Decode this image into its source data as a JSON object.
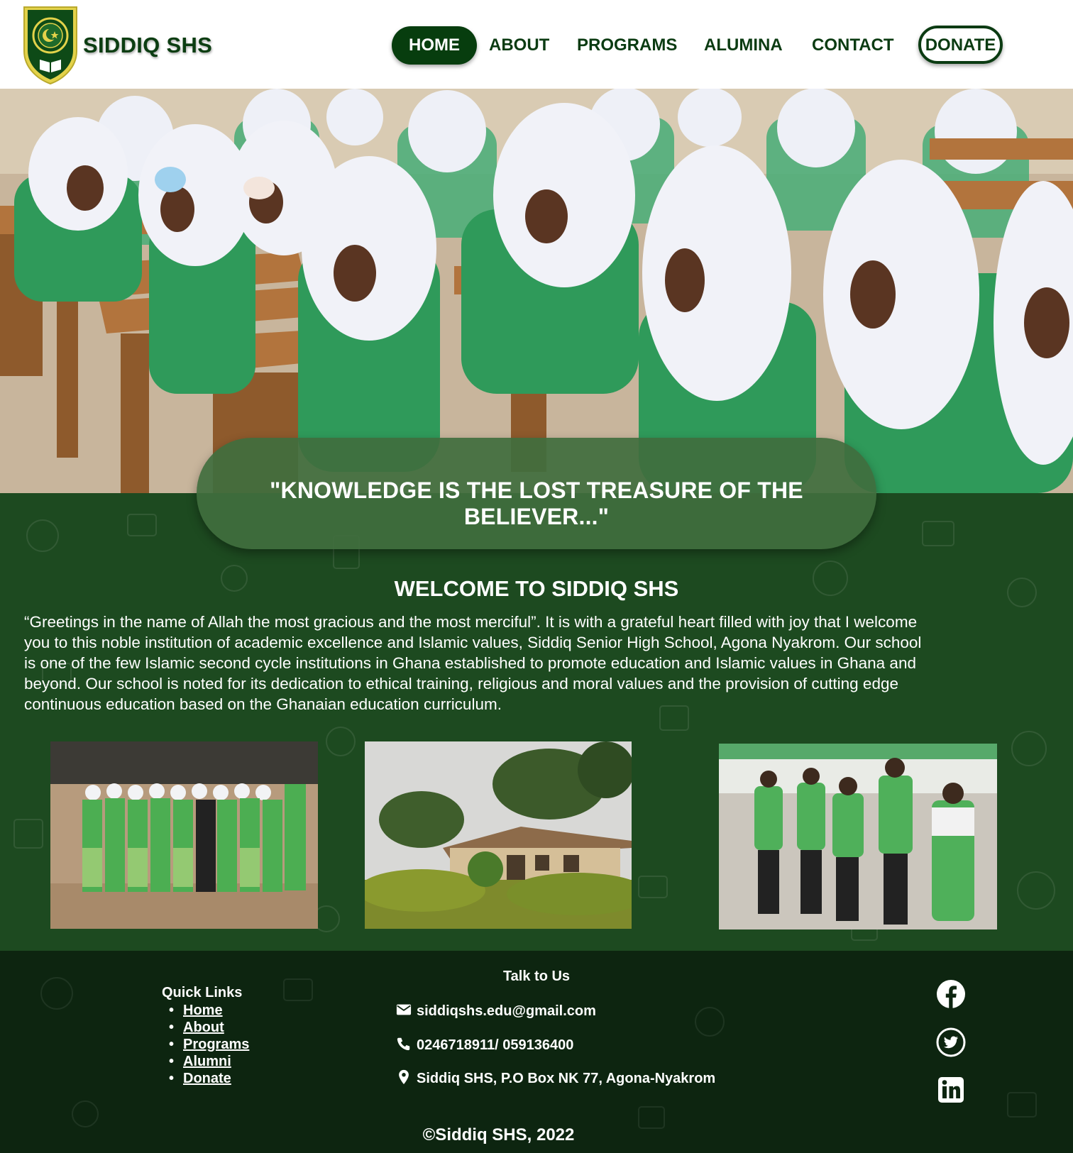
{
  "header": {
    "brand": "SIDDIQ SHS",
    "nav": {
      "home": "HOME",
      "about": "ABOUT",
      "programs": "PROGRAMS",
      "alumina": "ALUMINA",
      "contact": "CONTACT",
      "donate": "DONATE"
    }
  },
  "hero": {
    "quote": "\"KNOWLEDGE IS THE LOST TREASURE OF THE BELIEVER...\""
  },
  "welcome": {
    "title": "WELCOME TO SIDDIQ SHS",
    "body": "“Greetings in the name of Allah the most gracious and the most merciful”. It is with a grateful heart filled with joy that I welcome\n you to this noble institution of academic excellence and Islamic values, Siddiq Senior High School, Agona Nyakrom. Our school\nis one of the few Islamic second cycle institutions in Ghana established to promote education and Islamic values in Ghana and\nbeyond. Our school is noted for its dedication to ethical training, religious and moral values and the provision of cutting edge\n continuous education based on the Ghanaian education curriculum."
  },
  "footer": {
    "quick_links_title": "Quick Links",
    "quick_links": [
      "Home",
      "About",
      "Programs",
      "Alumni",
      "Donate"
    ],
    "talk_title": "Talk to Us",
    "email": "siddiqshs.edu@gmail.com",
    "phone": "0246718911/ 059136400",
    "address": "Siddiq SHS, P.O Box NK 77, Agona-Nyakrom",
    "copyright": "©Siddiq SHS, 2022",
    "social_icons": [
      "facebook-icon",
      "twitter-icon",
      "linkedin-icon"
    ]
  },
  "colors": {
    "brand_green": "#0b3b12",
    "section_green": "#1d4a20",
    "footer_green": "#0d2510",
    "quote_pill": "#406e3e"
  }
}
